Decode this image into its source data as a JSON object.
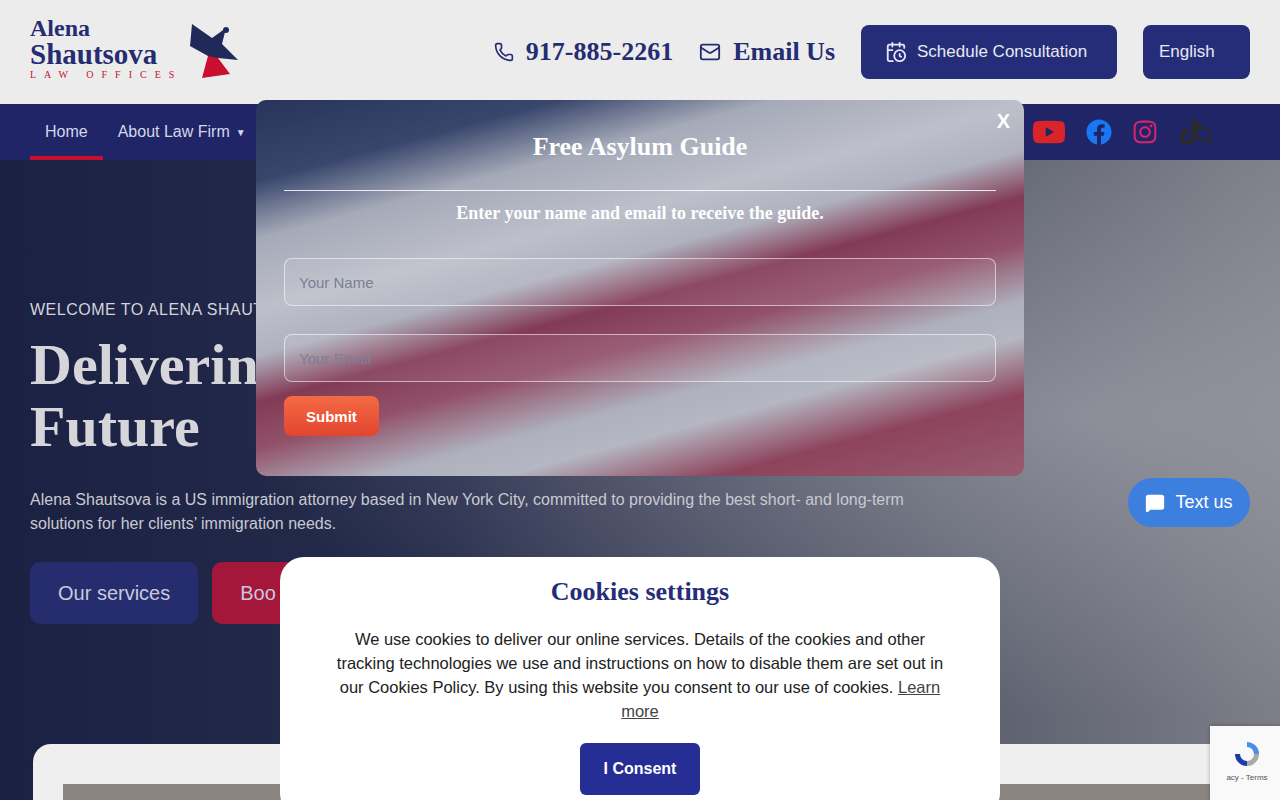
{
  "header": {
    "logo": {
      "first": "Alena",
      "last": "Shautsova",
      "tagline": "LAW OFFICES"
    },
    "phone": "917-885-2261",
    "email": "Email Us",
    "schedule": "Schedule Consultation",
    "language": "English"
  },
  "nav": {
    "items": [
      {
        "label": "Home",
        "selected": true,
        "dropdown": false
      },
      {
        "label": "About Law Firm",
        "selected": false,
        "dropdown": true
      }
    ],
    "dropdown_glyph": "▼"
  },
  "social": [
    {
      "kind": "youtube",
      "color": "#d9252a"
    },
    {
      "kind": "facebook",
      "color": "#1877f2"
    },
    {
      "kind": "instagram",
      "color": "#d6246e"
    },
    {
      "kind": "tiktok",
      "color": "#2b2b2b"
    }
  ],
  "hero": {
    "eyebrow": "WELCOME TO ALENA SHAUTO",
    "heading": [
      "Deliverin",
      "Future"
    ],
    "text": "Alena Shautsova is a US immigration attorney based in New York City, committed to providing the best short- and long-term solutions for her clients’ immigration needs.",
    "buttons": [
      {
        "label": "Our services",
        "kind": "primary"
      },
      {
        "label": "Boo",
        "kind": "accent"
      }
    ]
  },
  "modal": {
    "title": "Free Asylum Guide",
    "subtitle": "Enter your name and email to receive the guide.",
    "fields": [
      {
        "placeholder": "Your Name"
      },
      {
        "placeholder": "Your Email"
      }
    ],
    "submit": "Submit",
    "close": "X"
  },
  "cookies": {
    "title": "Cookies settings",
    "text": "We use cookies to deliver our online services. Details of the cookies and other tracking technologies we use and instructions on how to disable them are set out in our Cookies Policy. By using this website you consent to our use of cookies.",
    "link": "Learn more",
    "button": "I Consent"
  },
  "chat": {
    "label": "Text us"
  },
  "recaptcha": {
    "text": "acy - Terms"
  }
}
